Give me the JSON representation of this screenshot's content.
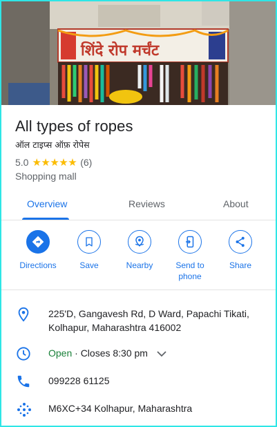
{
  "place": {
    "photo_sign_text": "शिंदे रोप मर्चंट",
    "title": "All types of ropes",
    "subtitle": "ऑल टाइप्स ऑफ़ रोपेस",
    "rating": "5.0",
    "stars": "★★★★★",
    "review_count": "(6)",
    "category": "Shopping mall"
  },
  "tabs": [
    {
      "label": "Overview",
      "active": true
    },
    {
      "label": "Reviews",
      "active": false
    },
    {
      "label": "About",
      "active": false
    }
  ],
  "actions": [
    {
      "label": "Directions",
      "icon": "directions-icon"
    },
    {
      "label": "Save",
      "icon": "bookmark-icon"
    },
    {
      "label": "Nearby",
      "icon": "nearby-icon"
    },
    {
      "label": "Send to phone",
      "icon": "send-to-phone-icon"
    },
    {
      "label": "Share",
      "icon": "share-icon"
    }
  ],
  "info": {
    "address_line1": "225'D, Gangavesh Rd, D Ward, Papachi Tikati,",
    "address_line2": "Kolhapur, Maharashtra 416002",
    "hours_status": "Open",
    "hours_detail": " · Closes 8:30 pm",
    "phone": "099228 61125",
    "plus_code": "M6XC+34 Kolhapur, Maharashtra"
  },
  "colors": {
    "accent": "#1a73e8",
    "open_green": "#188038",
    "star": "#fbbc04",
    "frame": "#2ee6e6"
  }
}
